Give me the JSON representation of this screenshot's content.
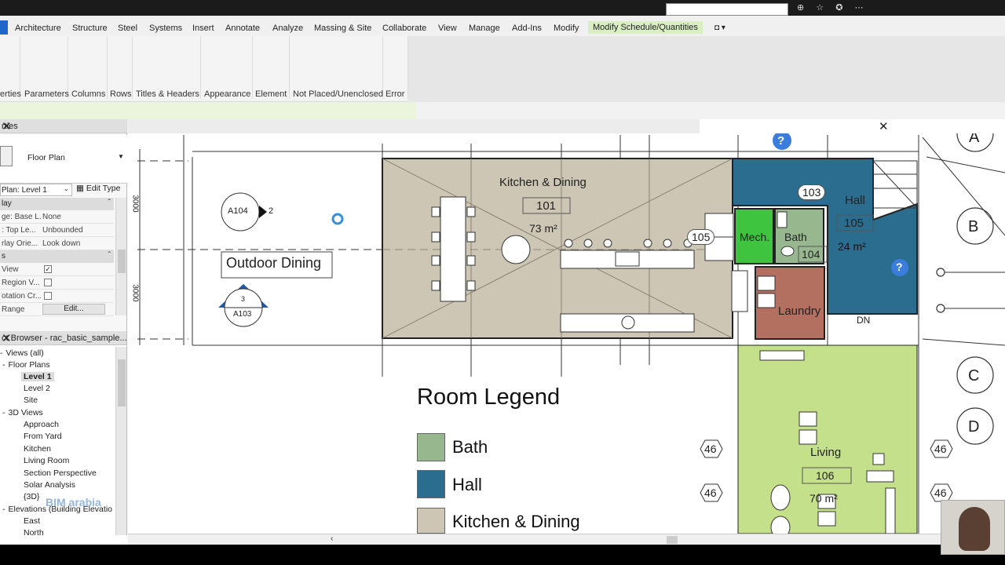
{
  "ribbon_tabs": [
    "Architecture",
    "Structure",
    "Steel",
    "Systems",
    "Insert",
    "Annotate",
    "Analyze",
    "Massing & Site",
    "Collaborate",
    "View",
    "Manage",
    "Add-Ins",
    "Modify",
    "Modify Schedule/Quantities"
  ],
  "ribbon_panels": [
    "erties",
    "Parameters",
    "Columns",
    "Rows",
    "Titles & Headers",
    "Appearance",
    "Element",
    "Not Placed/Unenclosed",
    "Error"
  ],
  "properties": {
    "title": "rties",
    "type_name": "Floor Plan",
    "selector": "Plan: Level 1",
    "edit_type": "Edit Type",
    "group1": "lay",
    "rows": [
      {
        "key": "ge: Base L...",
        "value": "None"
      },
      {
        "key": ": Top Le...",
        "value": "Unbounded"
      },
      {
        "key": "rlay Orie...",
        "value": "Look down"
      }
    ],
    "group2": "s",
    "check_rows": [
      {
        "key": "View",
        "checked": true
      },
      {
        "key": "Region V...",
        "checked": false
      },
      {
        "key": "otation Cr...",
        "checked": false
      }
    ],
    "range_key": "Range",
    "range_button": "Edit..."
  },
  "project_browser": {
    "title": "ct Browser - rac_basic_sample...",
    "items": [
      {
        "label": "Views (all)",
        "level": 0
      },
      {
        "label": "Floor Plans",
        "level": 1
      },
      {
        "label": "Level 1",
        "level": 2,
        "bold": true
      },
      {
        "label": "Level 2",
        "level": 2
      },
      {
        "label": "Site",
        "level": 2
      },
      {
        "label": "3D Views",
        "level": 1
      },
      {
        "label": "Approach",
        "level": 2
      },
      {
        "label": "From Yard",
        "level": 2
      },
      {
        "label": "Kitchen",
        "level": 2
      },
      {
        "label": "Living Room",
        "level": 2
      },
      {
        "label": "Section Perspective",
        "level": 2
      },
      {
        "label": "Solar Analysis",
        "level": 2
      },
      {
        "label": "{3D}",
        "level": 2
      },
      {
        "label": "Elevations (Building Elevatio",
        "level": 1
      },
      {
        "label": "East",
        "level": 2
      },
      {
        "label": "North",
        "level": 2
      }
    ]
  },
  "plan": {
    "rooms": [
      {
        "name": "Kitchen & Dining",
        "number": "101",
        "area": "73 m²",
        "color": "#cec6b5"
      },
      {
        "name": "Hall",
        "number": "105",
        "area": "24 m²",
        "color": "#2b6d8f"
      },
      {
        "name": "Mech.",
        "number": "",
        "area": "",
        "color": "#3fc43f"
      },
      {
        "name": "Bath",
        "number": "104",
        "area": "",
        "color": "#97b88f"
      },
      {
        "name": "Laundry",
        "number": "",
        "area": "",
        "color": "#b36f5f"
      },
      {
        "name": "Living",
        "number": "106",
        "area": "70 m²",
        "color": "#c4e08a"
      }
    ],
    "door_tags": [
      "103",
      "105"
    ],
    "outdoor_label": "Outdoor Dining",
    "callout_top": "A104",
    "callout_top_num": "2",
    "section_num": "3",
    "section_sheet": "A103",
    "dn_label": "DN",
    "grid_bubbles": [
      "A",
      "B",
      "C",
      "D"
    ],
    "level_tags": [
      "46",
      "46",
      "46",
      "46"
    ],
    "dim_labels": [
      "3000",
      "3000"
    ]
  },
  "legend": {
    "title": "Room Legend",
    "items": [
      {
        "label": "Bath",
        "color": "#97b88f"
      },
      {
        "label": "Hall",
        "color": "#2b6d8f"
      },
      {
        "label": "Kitchen & Dining",
        "color": "#cec6b5"
      }
    ]
  },
  "watermark": "BIM arabia",
  "colors": {
    "active_tab": "#d9efc2",
    "selection_blue": "#1e66c9"
  }
}
